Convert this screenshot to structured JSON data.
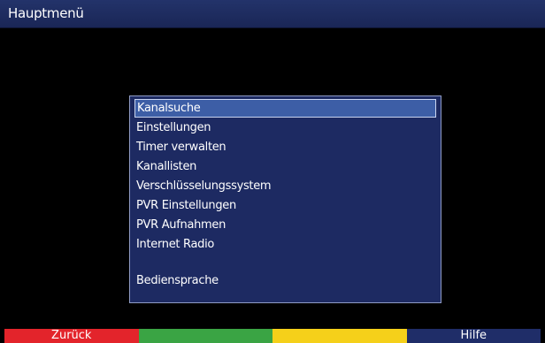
{
  "header": {
    "title": "Hauptmenü"
  },
  "menu": {
    "items": [
      {
        "label": "Kanalsuche",
        "selected": true
      },
      {
        "label": "Einstellungen"
      },
      {
        "label": "Timer verwalten"
      },
      {
        "label": "Kanallisten"
      },
      {
        "label": "Verschlüsselungssystem"
      },
      {
        "label": "PVR Einstellungen"
      },
      {
        "label": "PVR Aufnahmen"
      },
      {
        "label": "Internet Radio"
      },
      {
        "label": "Bediensprache"
      }
    ]
  },
  "footer": {
    "red_label": "Zurück",
    "green_label": "",
    "yellow_label": "",
    "blue_label": "Hilfe"
  },
  "colors": {
    "title_bar": "#1f2d5e",
    "menu_background": "#1d2a62",
    "selection": "#3d5ea6",
    "red": "#e3242b",
    "green": "#3aa444",
    "yellow": "#f5d01a",
    "blue": "#1f2d68"
  }
}
